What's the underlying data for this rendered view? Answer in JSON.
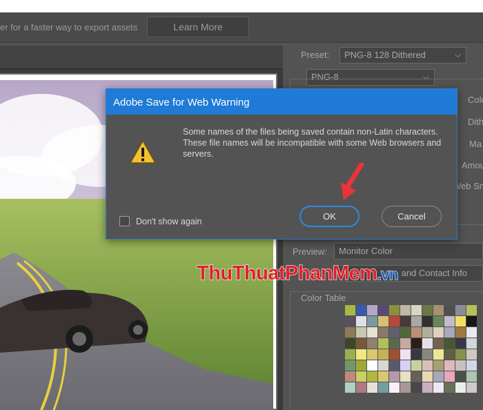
{
  "infobar": {
    "text": "er for a faster way to export assets",
    "learn_more_label": "Learn More"
  },
  "right_panel": {
    "preset_label": "Preset:",
    "preset_value": "PNG-8 128 Dithered",
    "format_value": "PNG-8",
    "partial_labels": [
      "Colo",
      "Dith",
      "Ma",
      "Amou",
      "Web Sn"
    ],
    "preview_label": "Preview:",
    "preview_value": "Monitor Color",
    "metadata_value": "and Contact Info",
    "color_table_label": "Color Table",
    "swatch_colors": [
      "#a8b840",
      "#3a5aa8",
      "#b0a8c8",
      "#5a4878",
      "#8a9040",
      "#c0b8a0",
      "#d8d8c0",
      "#6a7848",
      "#a89070",
      "#505050",
      "#8a8a9a",
      "#b8c058",
      "#5a5060",
      "#e0e0e8",
      "#7a9aa0",
      "#d8c070",
      "#b84838",
      "#4a3838",
      "#a8a8a8",
      "#303030",
      "#688858",
      "#c8b8d0",
      "#f0e060",
      "#181818",
      "#907858",
      "#c8c8b0",
      "#e8e0d0",
      "#887868",
      "#606070",
      "#506838",
      "#b89078",
      "#b0b098",
      "#e0d0c0",
      "#a8a8c0",
      "#a07840",
      "#e8e8f0",
      "#3a4828",
      "#785838",
      "#908070",
      "#b0c058",
      "#5a6850",
      "#c8a8a0",
      "#282018",
      "#e8e0e8",
      "#786050",
      "#485830",
      "#383848",
      "#d0d8d8",
      "#98b050",
      "#f0e880",
      "#d8c870",
      "#c8b058",
      "#a05030",
      "#f0e0f0",
      "#383840",
      "#888880",
      "#e8e898",
      "#606048",
      "#889048",
      "#d0c8c0",
      "#709868",
      "#a0a838",
      "#ffffff",
      "#d8d8d0",
      "#5a5870",
      "#d8d0f0",
      "#c8d0a0",
      "#d8c0b8",
      "#a8a070",
      "#e0b8c0",
      "#c8c0c0",
      "#d0d8e8",
      "#c08878",
      "#c8d060",
      "#b0b840",
      "#d8c870",
      "#b898a8",
      "#e8e0c0",
      "#686058",
      "#e8d8b0",
      "#a8a8b8",
      "#e8a8b8",
      "#485048",
      "#a8c8b0",
      "#b0d0c0",
      "#b07880",
      "#e8e0d8",
      "#70a0a0",
      "#f8f0f8",
      "#a89898",
      "#484848",
      "#c8b0c0",
      "#f0e8f0",
      "#687058",
      "#e8f0e8",
      "#d0c8d0"
    ]
  },
  "dialog": {
    "title": "Adobe Save for Web Warning",
    "message": "Some names of the files being saved contain non-Latin characters. These file names will be incompatible with some Web browsers and servers.",
    "checkbox_label": "Don't show again",
    "ok_label": "OK",
    "cancel_label": "Cancel"
  },
  "watermark": {
    "part1": "ThuThuat",
    "part2": "PhanMem",
    "part3": ".vn"
  },
  "colors": {
    "dialog_title_bg": "#1f7bd6",
    "ok_border": "#2d8be0",
    "arrow": "#e8343a"
  }
}
